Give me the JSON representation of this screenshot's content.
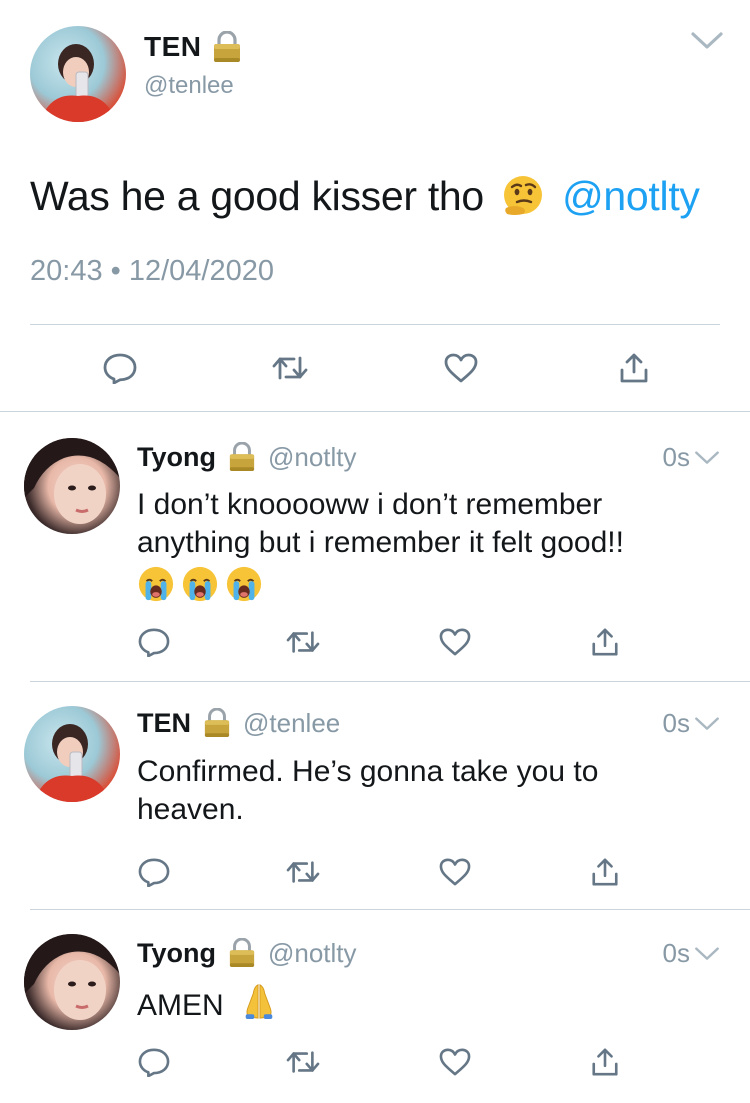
{
  "main_tweet": {
    "name": "TEN",
    "handle": "@tenlee",
    "text": "Was he a good kisser tho",
    "emoji": "thinking-face",
    "mention": "@notlty",
    "timestamp": "20:43 • 12/04/2020",
    "actions": [
      "reply-icon",
      "retweet-icon",
      "like-icon",
      "share-icon"
    ]
  },
  "replies": [
    {
      "name": "Tyong",
      "handle": "@notlty",
      "time": "0s",
      "line1": "I don’t knooooww i don’t remember",
      "line2": "anything but i remember it felt good!!",
      "emojis": [
        "loudly-crying-face",
        "loudly-crying-face",
        "loudly-crying-face"
      ]
    },
    {
      "name": "TEN",
      "handle": "@tenlee",
      "time": "0s",
      "line1": "Confirmed. He’s gonna take you to",
      "line2": "heaven."
    },
    {
      "name": "Tyong",
      "handle": "@notlty",
      "time": "0s",
      "line1": "AMEN",
      "emoji": "folded-hands"
    }
  ],
  "colors": {
    "text": "#14171a",
    "secondary": "#8899a6",
    "link": "#1da1f2",
    "divider": "#cdd5dc",
    "icon": "#657786"
  }
}
